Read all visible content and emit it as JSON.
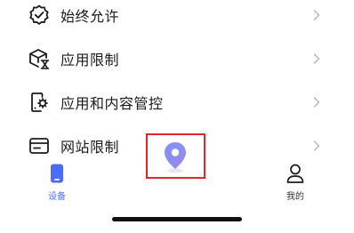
{
  "menu": {
    "items": [
      {
        "label": "始终允许",
        "icon": "shield-check-icon"
      },
      {
        "label": "应用限制",
        "icon": "app-hourglass-icon"
      },
      {
        "label": "应用和内容管控",
        "icon": "phone-gear-icon"
      },
      {
        "label": "网站限制",
        "icon": "browser-window-icon"
      }
    ],
    "chevron_icon": "chevron-right-icon"
  },
  "tabbar": {
    "tabs": [
      {
        "label": "设备",
        "icon": "phone-device-icon",
        "active": true
      },
      {
        "label": "我的",
        "icon": "person-icon",
        "active": false
      }
    ],
    "center_button_icon": "location-pin-icon"
  },
  "colors": {
    "accent": "#4a6cf7",
    "highlight": "#e0242a",
    "text": "#1b1b1b",
    "chevron": "#b8b8b8"
  }
}
